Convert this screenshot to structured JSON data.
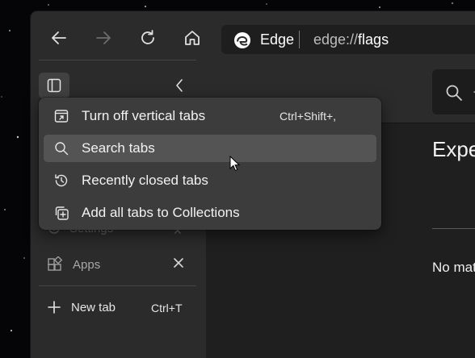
{
  "browser": {
    "site_name": "Edge",
    "url_scheme": "edge://",
    "url_path": "flags"
  },
  "sidebar": {
    "partial_item_label": "Settings",
    "apps_label": "Apps",
    "new_tab_label": "New tab",
    "new_tab_shortcut": "Ctrl+T"
  },
  "context_menu": {
    "items": [
      {
        "label": "Turn off vertical tabs",
        "shortcut": "Ctrl+Shift+,",
        "icon": "vertical-tabs-toggle-icon"
      },
      {
        "label": "Search tabs",
        "shortcut": "",
        "icon": "search-icon"
      },
      {
        "label": "Recently closed tabs",
        "shortcut": "",
        "icon": "history-icon"
      },
      {
        "label": "Add all tabs to Collections",
        "shortcut": "",
        "icon": "collections-add-icon"
      }
    ],
    "hovered_index": 1
  },
  "content": {
    "search_ellipsis": "..",
    "heading": "Expe",
    "no_match_text": "No mat"
  },
  "colors": {
    "window_bg": "#2b2b2b",
    "menu_bg": "#3c3c3c",
    "menu_hover": "#545454",
    "content_bg": "#1f1f1f"
  }
}
